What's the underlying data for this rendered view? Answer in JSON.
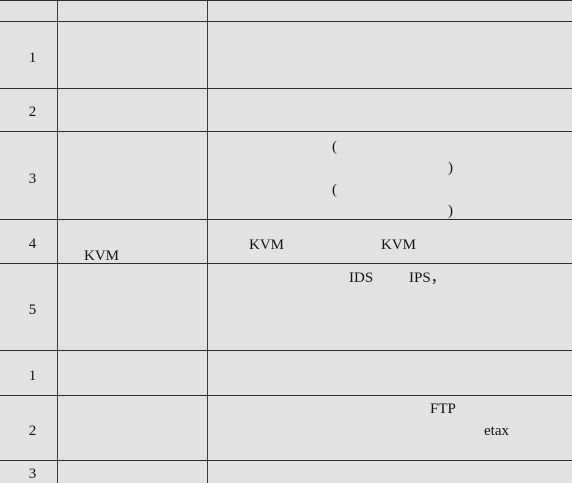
{
  "rows": [
    {
      "no": "1"
    },
    {
      "no": "2"
    },
    {
      "no": "3",
      "paren_open_1": "(",
      "paren_close_1": ")",
      "paren_open_2": "(",
      "paren_close_2": ")"
    },
    {
      "no": "4",
      "item": "KVM",
      "desc_a": "KVM",
      "desc_b": "KVM"
    },
    {
      "no": "5",
      "desc_ids": "IDS",
      "desc_ips": "IPS，"
    },
    {
      "no": "1"
    },
    {
      "no": "2",
      "desc_ftp": "FTP",
      "desc_etax": "etax"
    },
    {
      "no": "3"
    }
  ]
}
